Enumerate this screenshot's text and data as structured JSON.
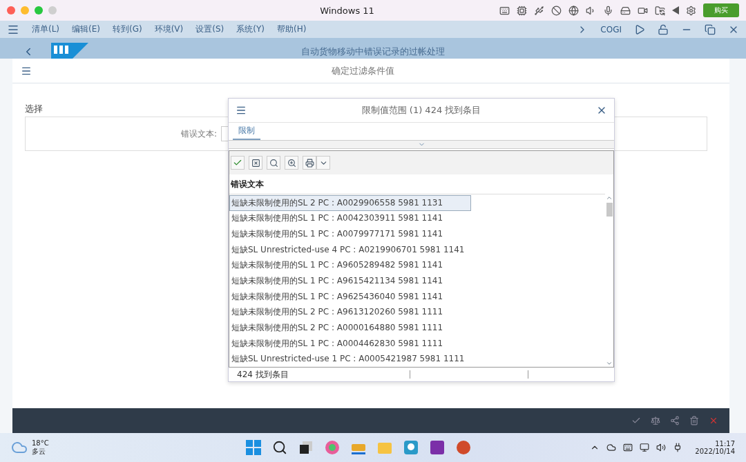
{
  "window": {
    "title": "Windows 11",
    "buy_button": "购买"
  },
  "menu_bar": {
    "items": [
      "清单(L)",
      "编辑(E)",
      "转到(G)",
      "环境(V)",
      "设置(S)",
      "系统(Y)",
      "帮助(H)"
    ],
    "transaction": "COGI"
  },
  "app_header": {
    "title": "自动货物移动中错误记录的过帐处理"
  },
  "dialog": {
    "title": "确定过滤条件值",
    "section": "选择",
    "field_label": "错误文本:"
  },
  "popup": {
    "title": "限制值范围 (1)  424 找到条目",
    "tabs": [
      {
        "label": "限制",
        "selected": true
      }
    ],
    "column": "错误文本",
    "rows": [
      {
        "text": "短缺未限制使用的SL 2 PC : A0029906558 5981 1131",
        "selected": true
      },
      {
        "text": "短缺未限制使用的SL 1 PC : A0042303911 5981 1141",
        "selected": false
      },
      {
        "text": "短缺未限制使用的SL 1 PC : A0079977171 5981 1141",
        "selected": false
      },
      {
        "text": "短缺SL Unrestricted-use 4 PC : A0219906701 5981 1141",
        "selected": false
      },
      {
        "text": "短缺未限制使用的SL 1 PC : A9605289482 5981 1141",
        "selected": false
      },
      {
        "text": "短缺未限制使用的SL 1 PC : A9615421134 5981 1141",
        "selected": false
      },
      {
        "text": "短缺未限制使用的SL 1 PC : A9625436040 5981 1141",
        "selected": false
      },
      {
        "text": "短缺未限制使用的SL 2 PC : A9613120260 5981 1111",
        "selected": false
      },
      {
        "text": "短缺未限制使用的SL 2 PC : A0000164880 5981 1111",
        "selected": false
      },
      {
        "text": "短缺未限制使用的SL 1 PC : A0004462830 5981 1111",
        "selected": false
      },
      {
        "text": "短缺SL Unrestricted-use 1 PC : A0005421987 5981 1111",
        "selected": false
      }
    ],
    "status": "424 找到条目"
  },
  "taskbar": {
    "temperature": "18°C",
    "weather": "多云",
    "time": "11:17",
    "date": "2022/10/14"
  }
}
